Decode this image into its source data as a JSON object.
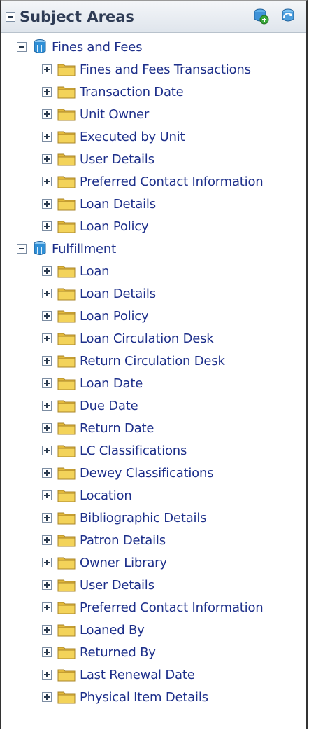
{
  "panel": {
    "title": "Subject Areas",
    "add_icon": "add-subject-area-icon",
    "refresh_icon": "refresh-icon"
  },
  "tree": [
    {
      "label": "Fines and Fees",
      "icon": "cube-icon",
      "expanded": true,
      "children": [
        "Fines and Fees Transactions",
        "Transaction Date",
        "Unit Owner",
        "Executed by Unit",
        "User Details",
        "Preferred Contact Information",
        "Loan Details",
        "Loan Policy"
      ]
    },
    {
      "label": "Fulfillment",
      "icon": "cube-icon",
      "expanded": true,
      "children": [
        "Loan",
        "Loan Details",
        "Loan Policy",
        "Loan Circulation Desk",
        "Return Circulation Desk",
        "Loan Date",
        "Due Date",
        "Return Date",
        "LC Classifications",
        "Dewey Classifications",
        "Location",
        "Bibliographic Details",
        "Patron Details",
        "Owner Library",
        "User Details",
        "Preferred Contact Information",
        "Loaned By",
        "Returned By",
        "Last Renewal Date",
        "Physical Item Details"
      ]
    }
  ],
  "colors": {
    "label": "#1d2f8a",
    "folder": "#f3d35a",
    "cube": "#2f8fd6"
  }
}
